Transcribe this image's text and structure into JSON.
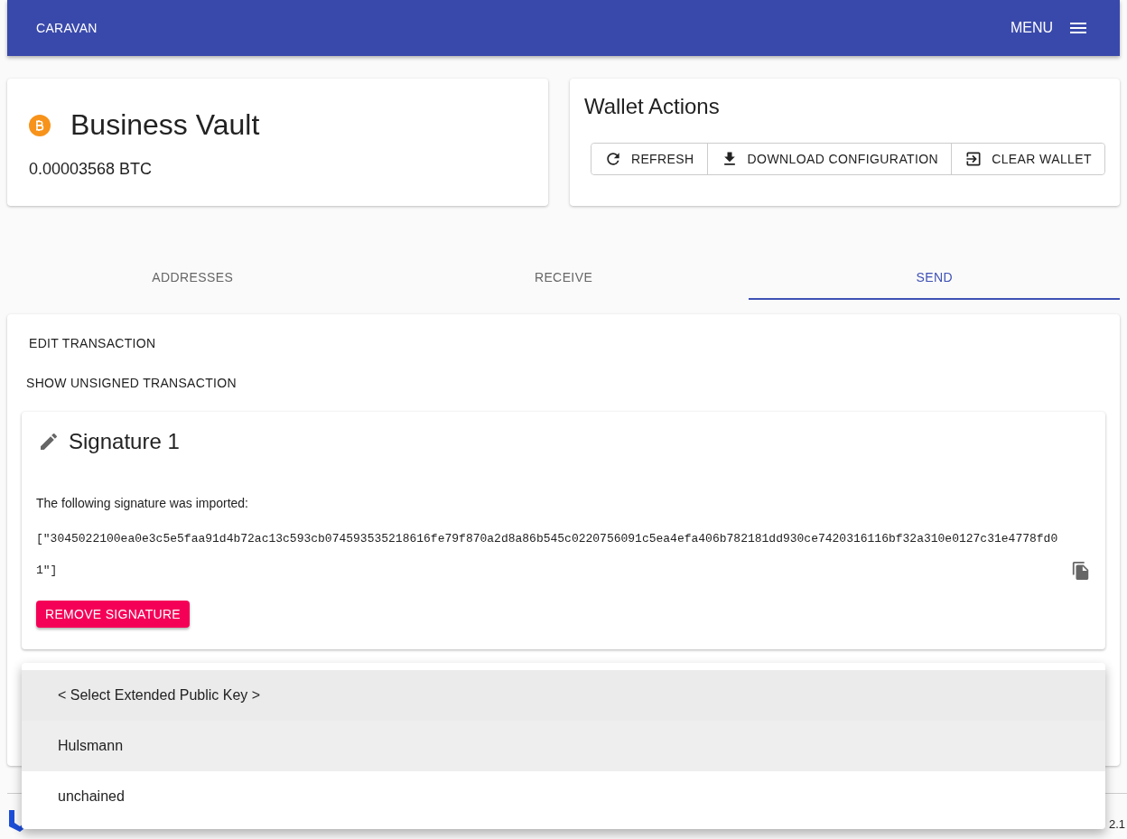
{
  "app_bar": {
    "title": "CARAVAN",
    "menu_label": "MENU"
  },
  "wallet": {
    "name": "Business Vault",
    "balance": "0.00003568 BTC"
  },
  "wallet_actions": {
    "title": "Wallet Actions",
    "buttons": [
      {
        "kind": "refresh",
        "label": "REFRESH"
      },
      {
        "kind": "download",
        "label": "DOWNLOAD CONFIGURATION"
      },
      {
        "kind": "clear",
        "label": "CLEAR WALLET"
      }
    ]
  },
  "tabs": [
    {
      "label": "ADDRESSES",
      "selected": false
    },
    {
      "label": "RECEIVE",
      "selected": false
    },
    {
      "label": "SEND",
      "selected": true
    }
  ],
  "send": {
    "edit_button": "EDIT TRANSACTION",
    "show_unsigned_button": "SHOW UNSIGNED TRANSACTION",
    "signature": {
      "title": "Signature 1",
      "message": "The following signature was imported:",
      "value": "[\"3045022100ea0e3c5e5faa91d4b72ac13c593cb074593535218616fe79f870a2d8a86b545c0220756091c5ea4efa406b782181dd930ce7420316116bf32a310e0127c31e4778fd01\"]",
      "remove_button": "REMOVE SIGNATURE"
    }
  },
  "dropdown_menu": [
    {
      "label": "< Select Extended Public Key >",
      "selected": true,
      "highlighted": false
    },
    {
      "label": "Hulsmann",
      "selected": false,
      "highlighted": true
    },
    {
      "label": "unchained",
      "selected": false,
      "highlighted": false
    }
  ],
  "footer": {
    "version": "2.1"
  }
}
